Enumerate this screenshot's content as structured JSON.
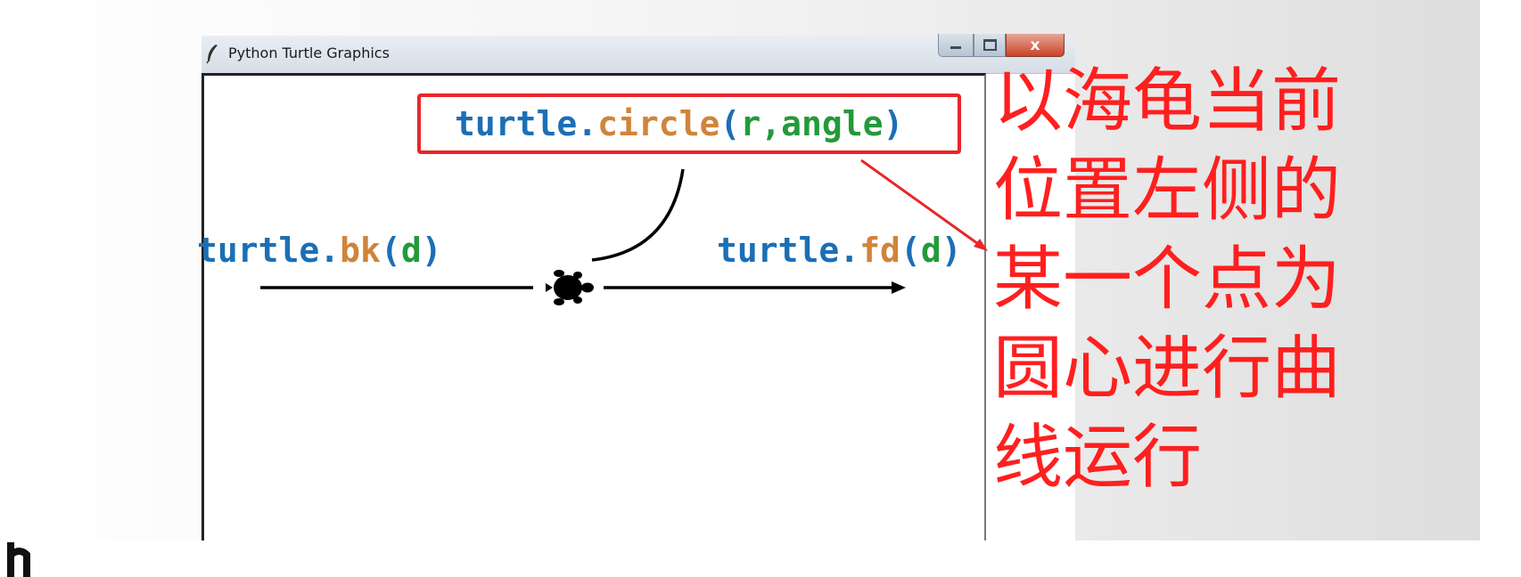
{
  "window": {
    "title": "Python Turtle Graphics",
    "controls": {
      "close_label": "x"
    }
  },
  "canvas": {
    "circle_code": {
      "obj": "turtle",
      "dot": ".",
      "method": "circle",
      "open": "(",
      "args": "r,angle",
      "close": ")"
    },
    "bk_code": {
      "obj": "turtle",
      "dot": ".",
      "method": "bk",
      "open": "(",
      "args": "d",
      "close": ")"
    },
    "fd_code": {
      "obj": "turtle",
      "dot": ".",
      "method": "fd",
      "open": "(",
      "args": "d",
      "close": ")"
    }
  },
  "annotation": {
    "text": "以海龟当前位置左侧的某一个点为圆心进行曲线运行"
  },
  "colors": {
    "code_object": "#1c6fb5",
    "code_method": "#d0843a",
    "code_args": "#239a3a",
    "annotation_red": "#ff1f1f"
  },
  "icons": [
    "feather-icon",
    "turtle-icon",
    "minimize-icon",
    "maximize-icon",
    "close-icon"
  ]
}
